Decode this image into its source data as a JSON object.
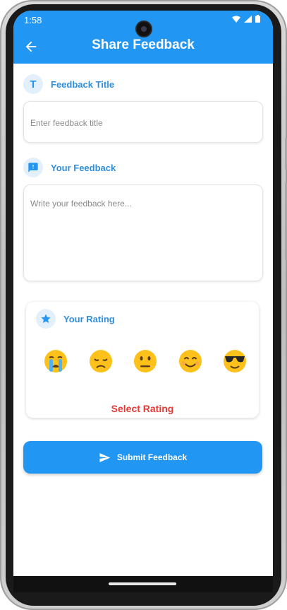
{
  "status_bar": {
    "time": "1:58"
  },
  "app_bar": {
    "title": "Share Feedback",
    "back_icon": "arrow-back-icon"
  },
  "title_section": {
    "icon_glyph": "T",
    "label": "Feedback Title",
    "placeholder": "Enter feedback title",
    "value": ""
  },
  "feedback_section": {
    "icon": "feedback-message-icon",
    "label": "Your Feedback",
    "placeholder": "Write your feedback here...",
    "value": ""
  },
  "rating_section": {
    "icon": "star-icon",
    "label": "Your Rating",
    "options": [
      "crying",
      "disappointed",
      "neutral",
      "smiling",
      "cool"
    ],
    "prompt": "Select Rating"
  },
  "submit": {
    "label": "Submit Feedback",
    "icon": "send-icon"
  },
  "colors": {
    "primary": "#2196f3",
    "accent_text": "#2f8fdc",
    "error": "#e53935"
  }
}
